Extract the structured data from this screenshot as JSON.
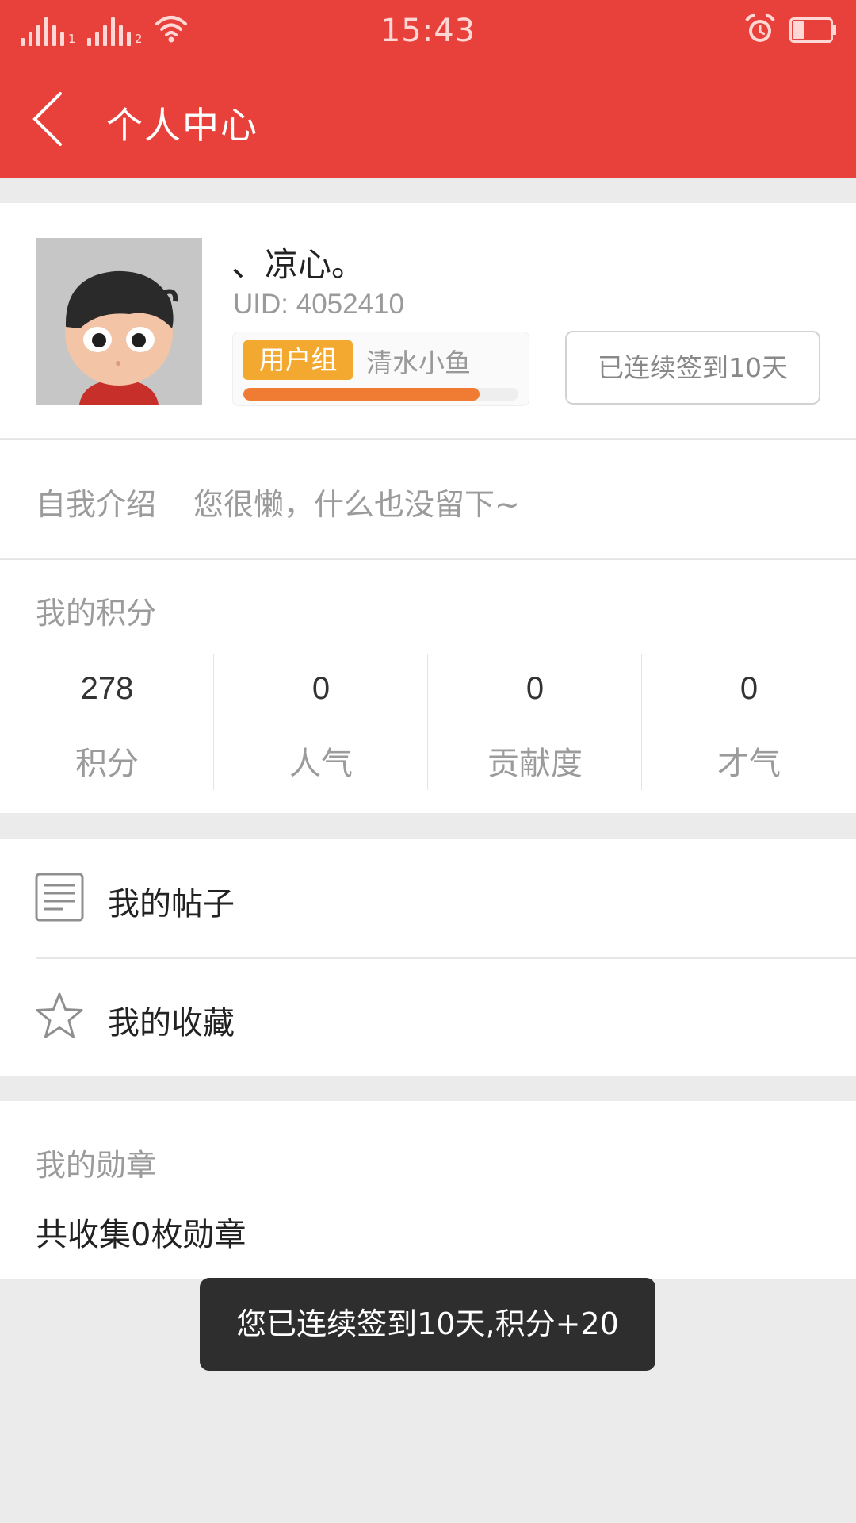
{
  "status_bar": {
    "time": "15:43",
    "sim1_label": "1",
    "sim2_label": "2",
    "battery_level": 0.3,
    "icons": [
      "signal-icon",
      "wifi-icon",
      "alarm-icon",
      "battery-icon"
    ]
  },
  "header": {
    "title": "个人中心",
    "back_icon": "chevron-left-icon",
    "background_color": "#e8403b"
  },
  "profile": {
    "username": "、凉心。",
    "uid": "UID: 4052410",
    "group_badge": "用户组",
    "group_name": "清水小鱼",
    "level_progress": 0.86,
    "checkin_label": "已连续签到10天"
  },
  "intro": {
    "label": "自我介绍",
    "text": "您很懒，什么也没留下~"
  },
  "points": {
    "title": "我的积分",
    "stats": [
      {
        "value": "278",
        "label": "积分"
      },
      {
        "value": "0",
        "label": "人气"
      },
      {
        "value": "0",
        "label": "贡献度"
      },
      {
        "value": "0",
        "label": "才气"
      }
    ]
  },
  "menu": {
    "items": [
      {
        "label": "我的帖子",
        "icon": "document-icon"
      },
      {
        "label": "我的收藏",
        "icon": "star-icon"
      }
    ]
  },
  "medals": {
    "title": "我的勋章",
    "text": "共收集0枚勋章"
  },
  "toast": {
    "text": "您已连续签到10天,积分+20"
  }
}
